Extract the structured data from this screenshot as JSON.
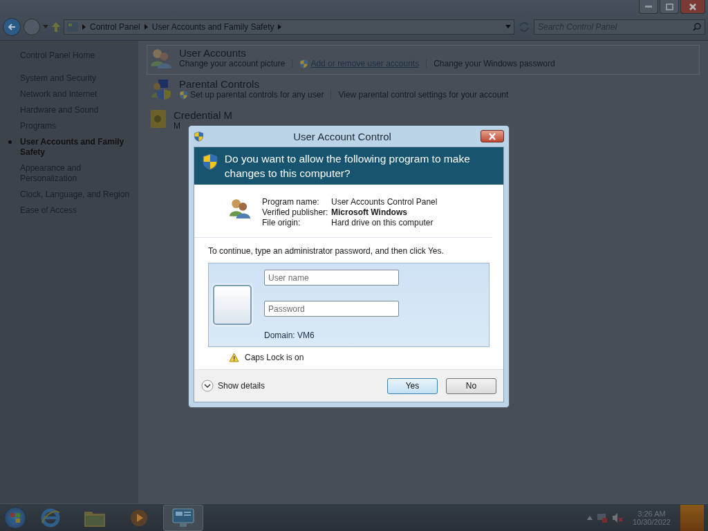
{
  "address_bar": {
    "breadcrumbs": [
      "Control Panel",
      "User Accounts and Family Safety"
    ]
  },
  "search": {
    "placeholder": "Search Control Panel"
  },
  "sidebar": {
    "home": "Control Panel Home",
    "items": [
      {
        "label": "System and Security",
        "selected": false
      },
      {
        "label": "Network and Internet",
        "selected": false
      },
      {
        "label": "Hardware and Sound",
        "selected": false
      },
      {
        "label": "Programs",
        "selected": false
      },
      {
        "label": "User Accounts and Family Safety",
        "selected": true
      },
      {
        "label": "Appearance and Personalization",
        "selected": false
      },
      {
        "label": "Clock, Language, and Region",
        "selected": false
      },
      {
        "label": "Ease of Access",
        "selected": false
      }
    ]
  },
  "categories": [
    {
      "kind": "users",
      "title": "User Accounts",
      "links": [
        {
          "text": "Change your account picture",
          "shield": false,
          "hovered": false
        },
        {
          "text": "Add or remove user accounts",
          "shield": true,
          "hovered": true
        },
        {
          "text": "Change your Windows password",
          "shield": false,
          "hovered": false
        }
      ]
    },
    {
      "kind": "parental",
      "title": "Parental Controls",
      "links": [
        {
          "text": "Set up parental controls for any user",
          "shield": true,
          "hovered": false
        },
        {
          "text": "View parental control settings for your account",
          "shield": false,
          "hovered": false
        }
      ]
    },
    {
      "kind": "vault",
      "title": "Credential M",
      "links": [
        {
          "text": "M",
          "shield": false,
          "hovered": false
        }
      ]
    }
  ],
  "dialog": {
    "title": "User Account Control",
    "question": "Do you want to allow the following program to make changes to this computer?",
    "info": [
      {
        "label": "Program name:",
        "value": "User Accounts Control Panel",
        "bold": false
      },
      {
        "label": "Verified publisher:",
        "value": "Microsoft Windows",
        "bold": true
      },
      {
        "label": "File origin:",
        "value": "Hard drive on this computer",
        "bold": false
      }
    ],
    "instruction": "To continue, type an administrator password, and then click Yes.",
    "fields": [
      {
        "placeholder": "User name"
      },
      {
        "placeholder": "Password"
      }
    ],
    "domain": "Domain: VM6",
    "warning": "Caps Lock is on",
    "details": "Show details",
    "buttons": [
      {
        "label": "Yes",
        "default": true
      },
      {
        "label": "No",
        "default": false
      }
    ]
  },
  "taskbar": {
    "items": [
      {
        "kind": "browser",
        "selected": false
      },
      {
        "kind": "folder",
        "selected": false
      },
      {
        "kind": "media",
        "selected": false
      },
      {
        "kind": "panel",
        "selected": true
      }
    ],
    "time": "3:26 AM",
    "date": "10/30/2022"
  }
}
